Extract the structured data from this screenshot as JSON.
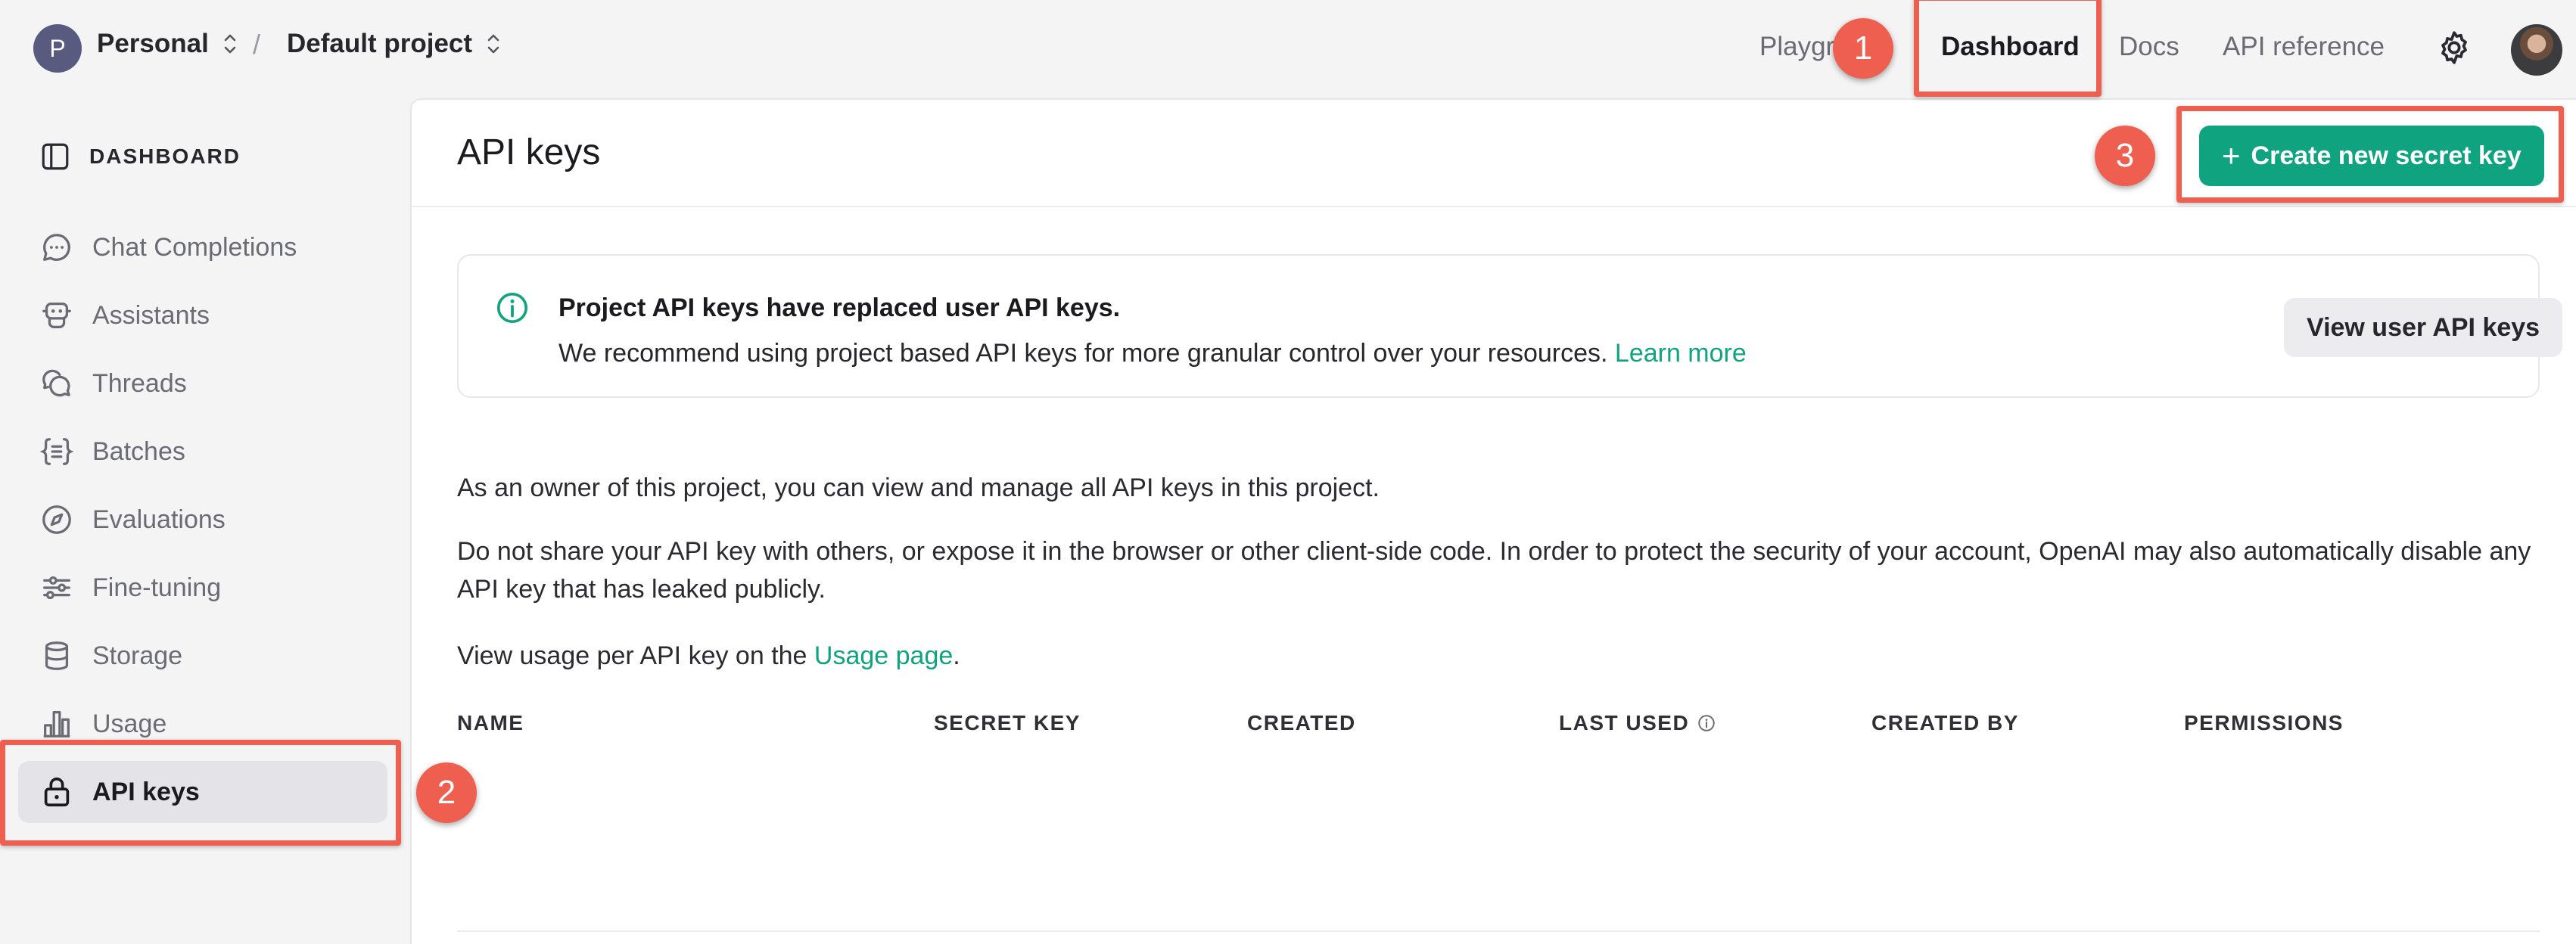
{
  "header": {
    "org_initial": "P",
    "org_name": "Personal",
    "separator": "/",
    "project_name": "Default project",
    "nav": {
      "playground": "Playground",
      "dashboard": "Dashboard",
      "docs": "Docs",
      "api_reference": "API reference"
    }
  },
  "sidebar": {
    "heading": "DASHBOARD",
    "items": [
      {
        "label": "Chat Completions",
        "icon": "chat-icon"
      },
      {
        "label": "Assistants",
        "icon": "robot-icon"
      },
      {
        "label": "Threads",
        "icon": "threads-icon"
      },
      {
        "label": "Batches",
        "icon": "batches-icon"
      },
      {
        "label": "Evaluations",
        "icon": "compass-icon"
      },
      {
        "label": "Fine-tuning",
        "icon": "sliders-icon"
      },
      {
        "label": "Storage",
        "icon": "database-icon"
      },
      {
        "label": "Usage",
        "icon": "bar-chart-icon"
      },
      {
        "label": "API keys",
        "icon": "lock-icon",
        "active": true
      }
    ]
  },
  "main": {
    "title": "API keys",
    "create_button": "Create new secret key",
    "notice": {
      "title": "Project API keys have replaced user API keys.",
      "body": "We recommend using project based API keys for more granular control over your resources.",
      "link": "Learn more",
      "button": "View user API keys"
    },
    "paragraph1": "As an owner of this project, you can view and manage all API keys in this project.",
    "paragraph2": "Do not share your API key with others, or expose it in the browser or other client-side code. In order to protect the security of your account, OpenAI may also automatically disable any API key that has leaked publicly.",
    "paragraph3_prefix": "View usage per API key on the",
    "paragraph3_link": "Usage page",
    "paragraph3_suffix": ".",
    "table_headers": [
      "NAME",
      "SECRET KEY",
      "CREATED",
      "LAST USED",
      "CREATED BY",
      "PERMISSIONS"
    ]
  },
  "annotations": {
    "badge1": "1",
    "badge2": "2",
    "badge3": "3"
  },
  "colors": {
    "accent": "#10a37f",
    "annotation": "#ef5f50"
  }
}
